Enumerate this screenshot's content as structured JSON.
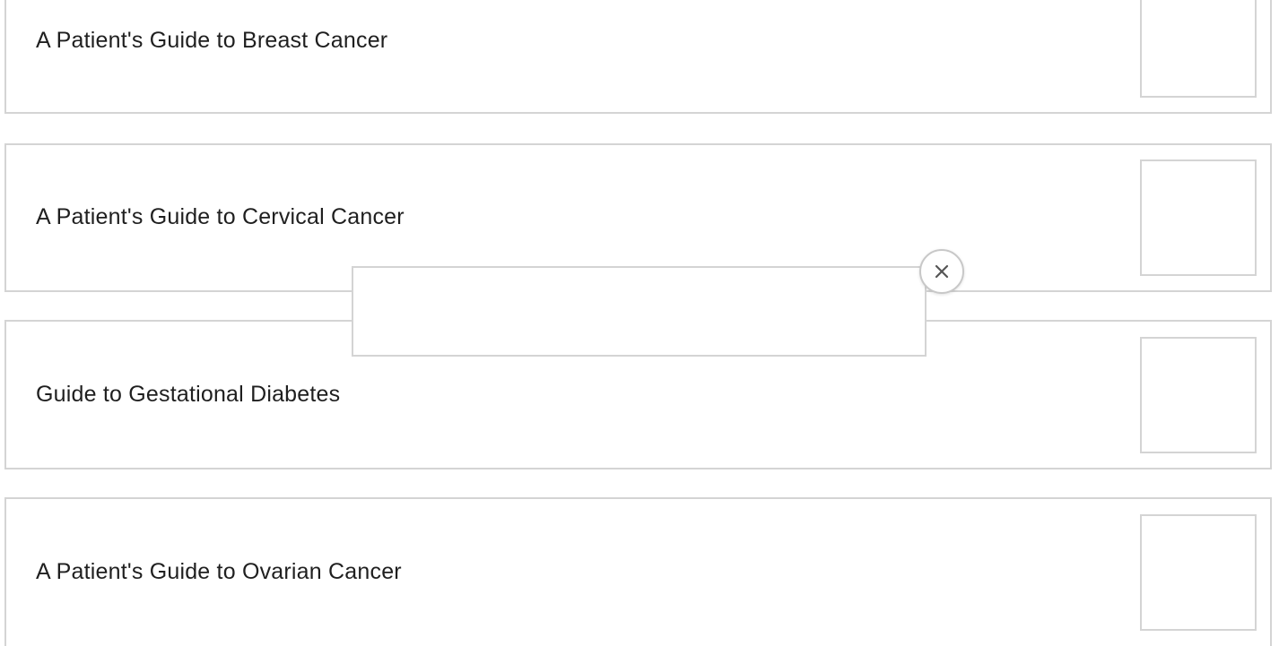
{
  "guides": [
    {
      "title": "A Patient's Guide to Breast Cancer"
    },
    {
      "title": "A Patient's Guide to Cervical Cancer"
    },
    {
      "title": "Guide to Gestational Diabetes"
    },
    {
      "title": "A Patient's Guide to Ovarian Cancer"
    }
  ],
  "popup": {
    "close_icon": "close-icon"
  },
  "colors": {
    "border": "#d4d4d4",
    "text": "#1f1f1f",
    "close_stroke": "#555555"
  }
}
